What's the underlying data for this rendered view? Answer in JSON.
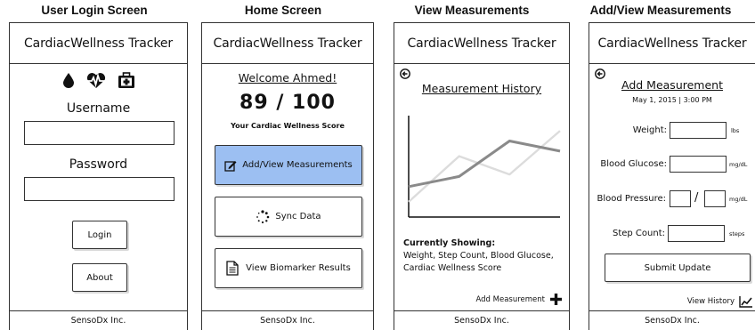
{
  "columns": [
    {
      "title": "User Login Screen"
    },
    {
      "title": "Home Screen"
    },
    {
      "title": "View Measurements"
    },
    {
      "title": "Add/View Measurements"
    }
  ],
  "app": {
    "name": "CardiacWellness Tracker",
    "footer": "SensoDx Inc."
  },
  "login": {
    "icons": [
      "drop-icon",
      "heart-rate-icon",
      "medical-kit-icon"
    ],
    "username_label": "Username",
    "password_label": "Password",
    "login_button": "Login",
    "about_button": "About"
  },
  "home": {
    "welcome": "Welcome Ahmed!",
    "score": "89 / 100",
    "score_caption": "Your Cardiac Wellness Score",
    "add_view_button": "Add/View Measurements",
    "sync_button": "Sync Data",
    "biomarker_button": "View Biomarker Results",
    "accent_color": "#9cbff2"
  },
  "view": {
    "heading": "Measurement History",
    "showing_title": "Currently Showing:",
    "showing_line1": "Weight, Step Count, Blood Glucose,",
    "showing_line2": "Cardiac Wellness Score",
    "add_link": "Add Measurement"
  },
  "add": {
    "heading": "Add Measurement",
    "datetime": "May 1, 2015 | 3:00 PM",
    "weight_label": "Weight:",
    "weight_unit": "lbs",
    "glucose_label": "Blood Glucose:",
    "glucose_unit": "mg/dL",
    "pressure_label": "Blood Pressure:",
    "pressure_sep": "/",
    "pressure_unit": "mg/dL",
    "steps_label": "Step Count:",
    "steps_unit": "steps",
    "submit_button": "Submit Update",
    "history_link": "View History"
  },
  "chart_data": {
    "type": "line",
    "title": "",
    "xlabel": "",
    "ylabel": "",
    "x": [
      0,
      1,
      2,
      3
    ],
    "series": [
      {
        "values": [
          3,
          4,
          7.5,
          6.5
        ]
      },
      {
        "values": [
          1.5,
          6,
          4.2,
          8.5
        ]
      }
    ],
    "ylim": [
      0,
      10
    ],
    "grid": false
  }
}
